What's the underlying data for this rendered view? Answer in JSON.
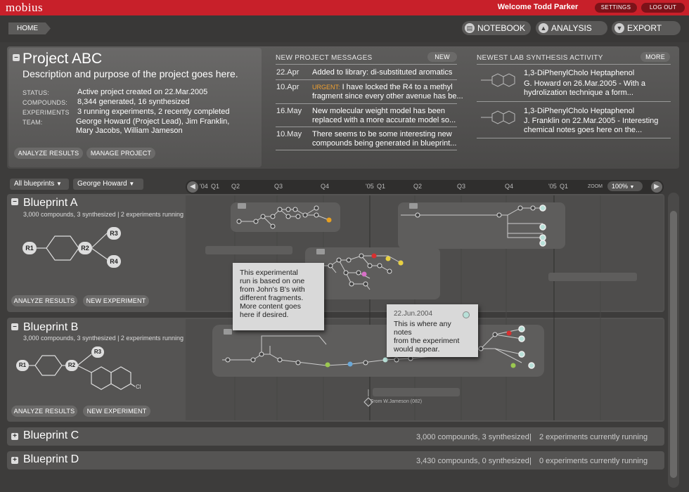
{
  "header": {
    "logo": "mobius",
    "welcome": "Welcome Todd Parker",
    "settings": "SETTINGS",
    "logout": "LOG OUT"
  },
  "nav": {
    "home": "HOME",
    "notebook": "NOTEBOOK",
    "analysis": "ANALYSIS",
    "export": "EXPORT"
  },
  "project": {
    "title": "Project ABC",
    "description": "Description and purpose of the project goes here.",
    "status_label": "STATUS:",
    "status": "Active project created on 22.Mar.2005",
    "compounds_label": "COMPOUNDS:",
    "compounds": "8,344 generated, 16 synthesized",
    "experiments_label": "EXPERIMENTS",
    "experiments": "3 running experiments, 2 recently completed",
    "team_label": "TEAM:",
    "team_1": "George Howard (Project Lead), Jim Franklin,",
    "team_2": "Mary Jacobs, William Jameson",
    "analyze": "ANALYZE RESULTS",
    "manage": "MANAGE PROJECT"
  },
  "messages": {
    "heading": "NEW PROJECT MESSAGES",
    "new_btn": "NEW",
    "items": [
      {
        "date": "22.Apr",
        "line1": "Added to library: di-substituted aromatics",
        "line2": ""
      },
      {
        "date": "10.Apr",
        "urgent": "URGENT:",
        "line1": " I have locked the R4 to a methyl",
        "line2": "fragment since every other avenue has be..."
      },
      {
        "date": "16.May",
        "line1": "New molecular weight model has been",
        "line2": "replaced with a more accurate model so..."
      },
      {
        "date": "10.May",
        "line1": "There seems to be some interesting new",
        "line2": "compounds being generated in blueprint..."
      }
    ]
  },
  "activity": {
    "heading": "NEWEST LAB SYNTHESIS ACTIVITY",
    "more_btn": "MORE",
    "items": [
      {
        "title": "1,3-DiPhenylCholo Heptaphenol",
        "line1": "G. Howard on 26.Mar.2005 - With a",
        "line2": "hydrolization technique a form..."
      },
      {
        "title": "1,3-DiPhenylCholo Heptaphenol",
        "line1": "J. Franklin on 22.Mar.2005 - Interesting",
        "line2": "chemical notes goes here on the..."
      }
    ]
  },
  "filters": {
    "blueprints": "All blueprints",
    "person": "George Howard"
  },
  "timeline": {
    "ticks": [
      "'04",
      "Q1",
      "Q2",
      "Q3",
      "Q4",
      "'05",
      "Q1",
      "Q2",
      "Q3",
      "Q4",
      "'05",
      "Q1"
    ],
    "zoom_label": "ZOOM",
    "zoom_value": "100%"
  },
  "blueprints": {
    "a": {
      "title": "Blueprint A",
      "sub": "3,000 compounds, 3 synthesized  |  2 experiments running",
      "analyze": "ANALYZE RESULTS",
      "new_exp": "NEW EXPERIMENT"
    },
    "b": {
      "title": "Blueprint B",
      "sub": "3,000 compounds, 3 synthesized  |  2 experiments running",
      "analyze": "ANALYZE RESULTS",
      "new_exp": "NEW EXPERIMENT",
      "from_note": "From W.Jameson (082)"
    },
    "c": {
      "title": "Blueprint C",
      "compounds": "3,000 compounds, 3 synthesized",
      "experiments": "2 experiments currently running"
    },
    "d": {
      "title": "Blueprint D",
      "compounds": "3,430 compounds, 0 synthesized",
      "experiments": "0 experiments currently running"
    }
  },
  "molecule_labels": {
    "r1": "R1",
    "r2": "R2",
    "r3": "R3",
    "r4": "R4",
    "cl": "Cl"
  },
  "tooltip1": {
    "l1": "This experimental",
    "l2": "run is based on one",
    "l3": "from John's B's with",
    "l4": "different fragments.",
    "l5": "More content goes",
    "l6": "here if desired."
  },
  "tooltip2": {
    "date": "22.Jun.2004",
    "l1": "This is where any notes",
    "l2": "from the experiment",
    "l3": "would appear."
  },
  "colors": {
    "brand_red": "#c8202a",
    "urgent": "#f0a030",
    "node_yellow": "#e8d040",
    "node_green": "#9bc850",
    "node_blue": "#6aa8d8",
    "node_red": "#d83030",
    "node_pink": "#d870c8",
    "node_orange": "#e8a020",
    "node_ringed": "#b8e0d8"
  }
}
